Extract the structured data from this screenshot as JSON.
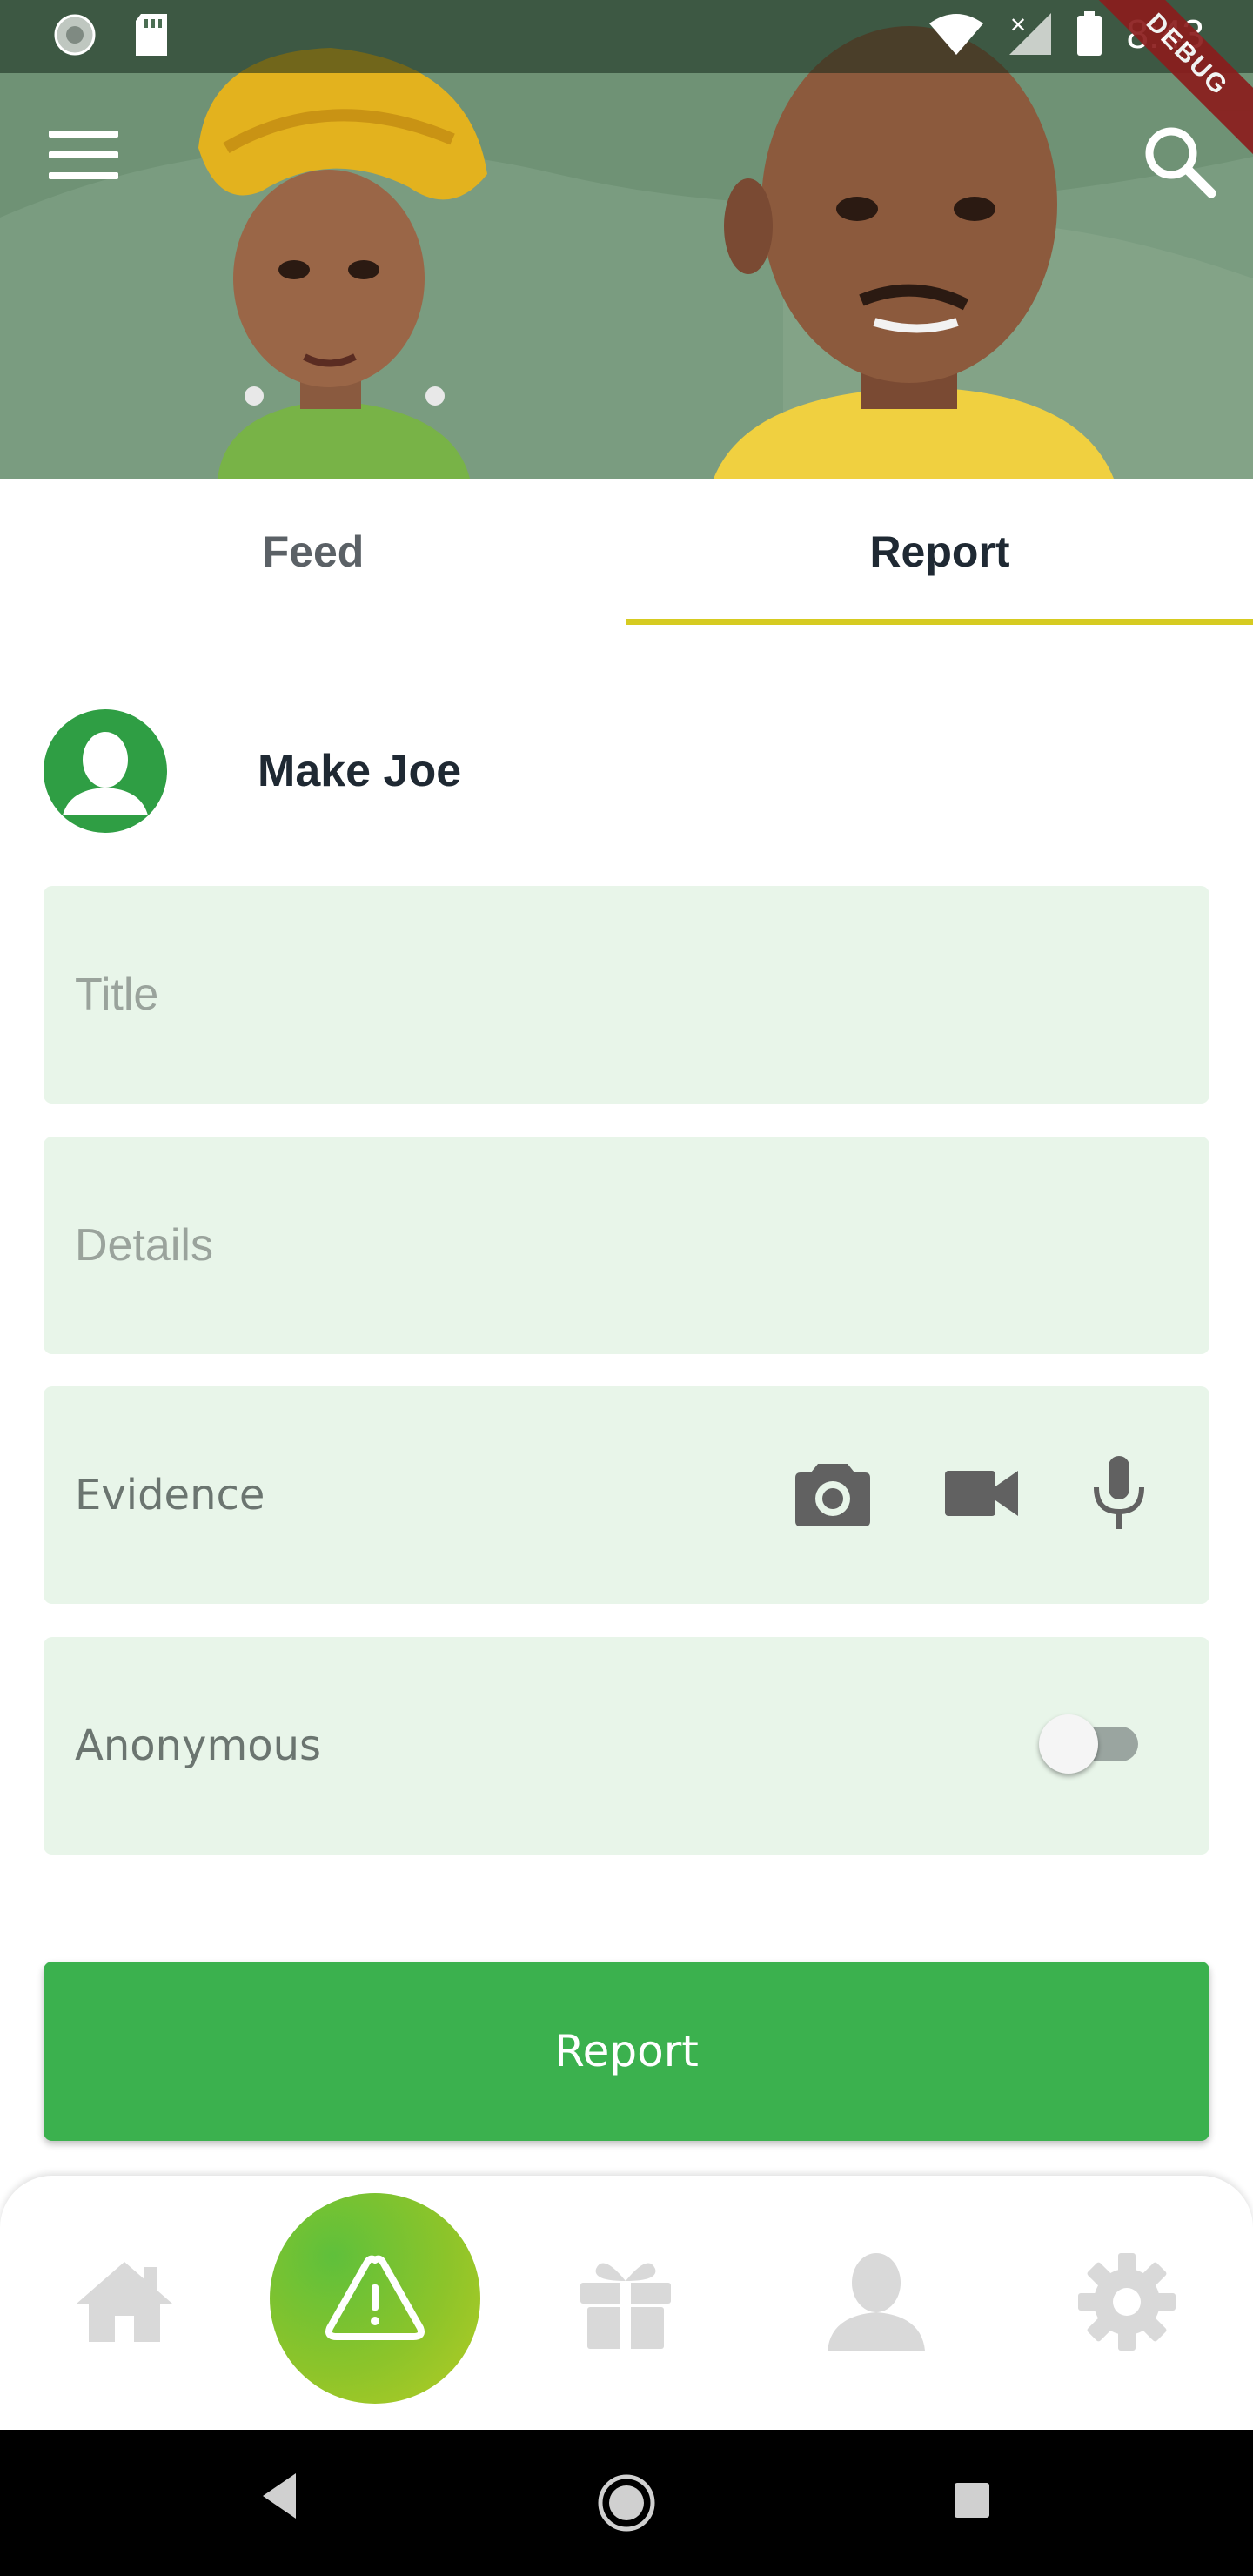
{
  "status_bar": {
    "time": "8:43",
    "debug_label": "DEBUG"
  },
  "header": {
    "menu_icon": "hamburger-menu-icon",
    "search_icon": "search-icon"
  },
  "tabs": [
    {
      "label": "Feed",
      "active": false
    },
    {
      "label": "Report",
      "active": true
    }
  ],
  "user": {
    "name": "Make Joe",
    "avatar_icon": "person-icon"
  },
  "form": {
    "title_placeholder": "Title",
    "details_placeholder": "Details",
    "evidence_label": "Evidence",
    "evidence_icons": [
      "camera-icon",
      "video-camera-icon",
      "microphone-icon"
    ],
    "anonymous_label": "Anonymous",
    "anonymous_on": false,
    "submit_label": "Report"
  },
  "bottom_nav": {
    "items": [
      "home-icon",
      "report-warning-icon",
      "gift-icon",
      "profile-icon",
      "settings-icon"
    ],
    "active": "report-warning-icon"
  },
  "colors": {
    "primary_green": "#3bb14e",
    "field_bg": "#e8f5e9",
    "tab_indicator": "#d6cb21",
    "icon_grey": "#616161",
    "nav_icon_grey": "#d9d9d9"
  }
}
